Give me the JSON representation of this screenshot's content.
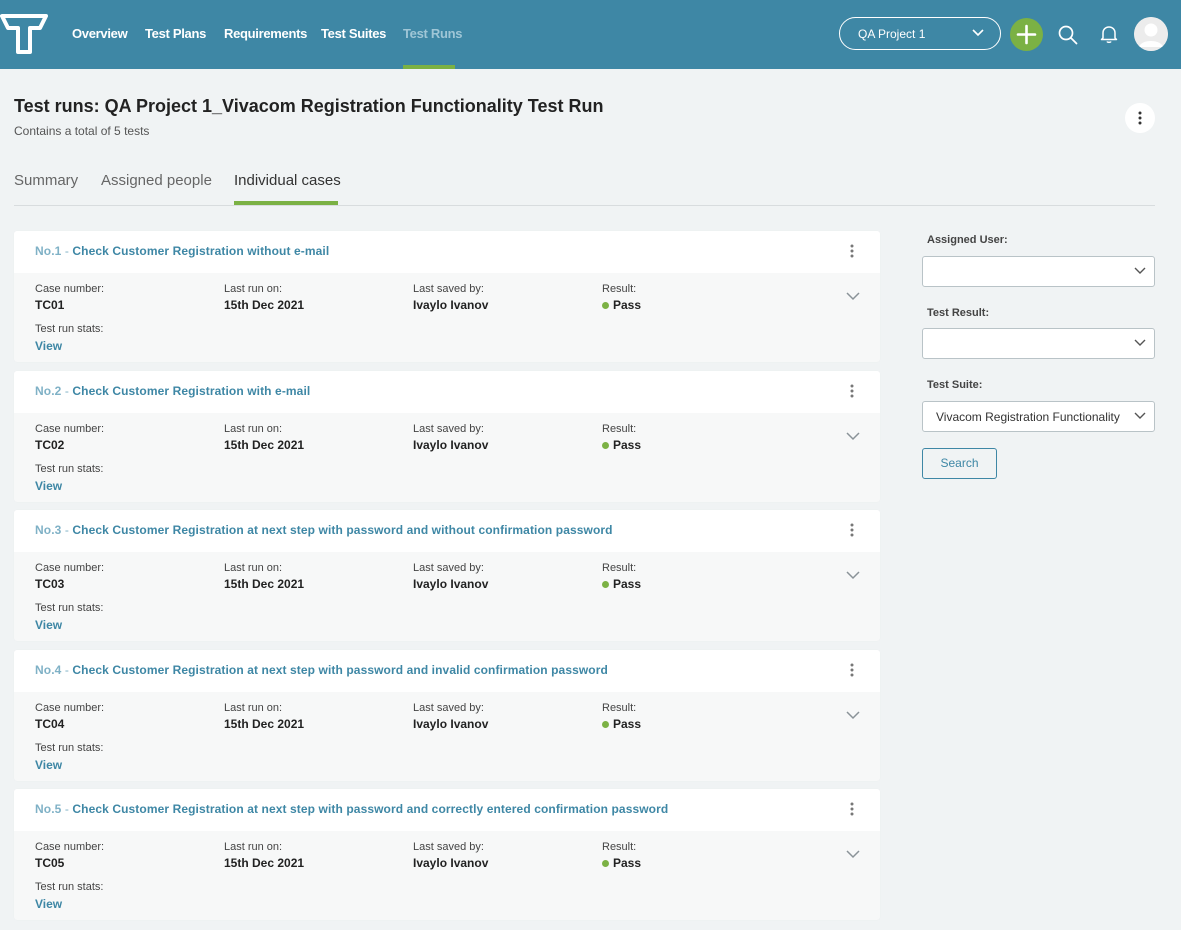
{
  "nav": {
    "items": [
      {
        "label": "Overview"
      },
      {
        "label": "Test Plans"
      },
      {
        "label": "Requirements"
      },
      {
        "label": "Test Suites"
      },
      {
        "label": "Test Runs"
      }
    ],
    "active_item": "Test Runs",
    "project_select": "QA Project 1"
  },
  "colors": {
    "nav_background": "#3e87a5",
    "accent_green": "#7bb144",
    "link_blue": "#3e87a5",
    "page_background": "#f0f3f4"
  },
  "header": {
    "title": "Test runs: QA Project 1_Vivacom Registration Functionality Test Run",
    "subtitle": "Contains a total of 5 tests"
  },
  "tabs": [
    {
      "label": "Summary"
    },
    {
      "label": "Assigned people"
    },
    {
      "label": "Individual cases"
    }
  ],
  "active_tab": "Individual cases",
  "field_labels": {
    "case_number": "Case number:",
    "last_run_on": "Last run on:",
    "last_saved_by": "Last saved by:",
    "result": "Result:",
    "test_run_stats": "Test run stats:",
    "view": "View"
  },
  "cases": [
    {
      "no": "No.1",
      "name": "Check Customer Registration without e-mail",
      "case_number": "TC01",
      "last_run": "15th Dec 2021",
      "saved_by": "Ivaylo Ivanov",
      "result": "Pass"
    },
    {
      "no": "No.2",
      "name": "Check Customer Registration with e-mail",
      "case_number": "TC02",
      "last_run": "15th Dec 2021",
      "saved_by": "Ivaylo Ivanov",
      "result": "Pass"
    },
    {
      "no": "No.3",
      "name": "Check Customer Registration at next step with password and without confirmation password",
      "case_number": "TC03",
      "last_run": "15th Dec 2021",
      "saved_by": "Ivaylo Ivanov",
      "result": "Pass"
    },
    {
      "no": "No.4",
      "name": "Check Customer Registration at next step with password and invalid confirmation password",
      "case_number": "TC04",
      "last_run": "15th Dec 2021",
      "saved_by": "Ivaylo Ivanov",
      "result": "Pass"
    },
    {
      "no": "No.5",
      "name": "Check Customer Registration at next step with password and correctly entered confirmation password",
      "case_number": "TC05",
      "last_run": "15th Dec 2021",
      "saved_by": "Ivaylo Ivanov",
      "result": "Pass"
    }
  ],
  "filters": {
    "assigned_user": {
      "label": "Assigned User:",
      "value": ""
    },
    "test_result": {
      "label": "Test Result:",
      "value": ""
    },
    "test_suite": {
      "label": "Test Suite:",
      "value": "Vivacom Registration Functionality"
    },
    "search_label": "Search"
  },
  "icons": [
    "logo-icon",
    "chevron-down-icon",
    "plus-icon",
    "search-icon",
    "bell-icon",
    "avatar-icon",
    "kebab-icon"
  ]
}
